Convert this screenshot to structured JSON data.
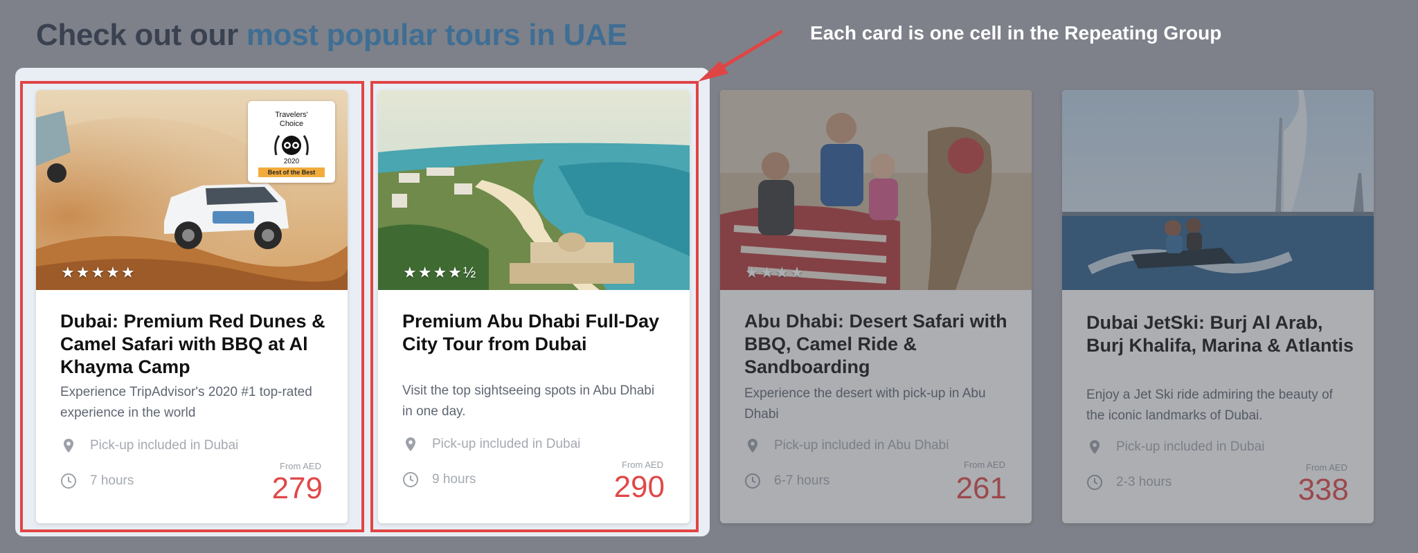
{
  "heading": {
    "prefix": "Check out our ",
    "accent": "most popular tours in UAE"
  },
  "annotation": "Each card is one cell in the Repeating Group",
  "colors": {
    "background": "#7e8189",
    "accent_blue": "#3f6e94",
    "price_red": "#e04848",
    "highlight_red": "#e04545"
  },
  "badge": {
    "line1": "Travelers'",
    "line2": "Choice",
    "year": "2020",
    "ribbon": "Best of the Best",
    "icon": "tripadvisor-owl-icon"
  },
  "tours": [
    {
      "title": "Dubai: Premium Red Dunes & Camel Safari with BBQ at Al Khayma Camp",
      "description": "Experience TripAdvisor's 2020 #1 top-rated experience in the world",
      "pickup": "Pick-up included in Dubai",
      "duration": "7 hours",
      "price_label": "From AED",
      "price": "279",
      "rating": 5,
      "stars": "★★★★★",
      "image": "desert-safari-jeep-image",
      "highlighted": true
    },
    {
      "title": "Premium Abu Dhabi Full-Day City Tour from Dubai",
      "description": "Visit the top sightseeing spots in Abu Dhabi in one day.",
      "pickup": "Pick-up included in Dubai",
      "duration": "9 hours",
      "price_label": "From AED",
      "price": "290",
      "rating": 4.5,
      "stars": "★★★★½",
      "image": "abu-dhabi-aerial-image",
      "highlighted": true
    },
    {
      "title": "Abu Dhabi: Desert Safari with BBQ, Camel Ride & Sandboarding",
      "description": "Experience the desert with pick-up in Abu Dhabi",
      "pickup": "Pick-up included in Abu Dhabi",
      "duration": "6-7 hours",
      "price_label": "From AED",
      "price": "261",
      "rating": 4,
      "stars": "★★★★",
      "image": "camel-ride-family-image",
      "highlighted": false
    },
    {
      "title": "Dubai JetSki: Burj Al Arab, Burj Khalifa, Marina & Atlantis",
      "description": "Enjoy a Jet Ski ride admiring the beauty of the iconic landmarks of Dubai.",
      "pickup": "Pick-up included in Dubai",
      "duration": "2-3 hours",
      "price_label": "From AED",
      "price": "338",
      "rating": null,
      "stars": "",
      "image": "jetski-burj-al-arab-image",
      "highlighted": false
    }
  ]
}
